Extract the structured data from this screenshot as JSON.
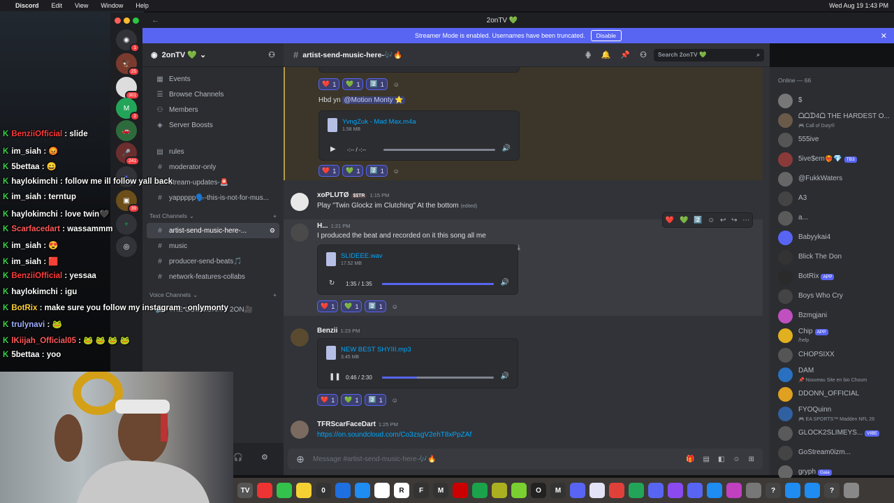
{
  "menubar": {
    "app": "Discord",
    "items": [
      "Edit",
      "View",
      "Window",
      "Help"
    ],
    "datetime": "Wed Aug 19 1:43 PM"
  },
  "window": {
    "title": "2onTV 💚"
  },
  "banner": {
    "text": "Streamer Mode is enabled. Usernames have been truncated.",
    "button": "Disable"
  },
  "guild_rail": {
    "badges": [
      "1",
      "25",
      "301",
      "2",
      "241",
      "39"
    ]
  },
  "sidebar": {
    "guild_name": "2onTV 💚",
    "nav": [
      "Events",
      "Browse Channels",
      "Members",
      "Server Boosts"
    ],
    "channels_top": [
      "rules",
      "moderator-only",
      "stream-updates-🚨",
      "yappppp🗣️-this-is-not-for-mus..."
    ],
    "text_category": "Text Channels",
    "text_channels": [
      "artist-send-music-here-...",
      "music",
      "producer-send-beats🎵",
      "network-features-collabs"
    ],
    "voice_category": "Voice Channels",
    "voice_channels": [
      "THE COMMUNITY 2ON🎥"
    ]
  },
  "chat": {
    "channel": "artist-send-music-here-🎶🔥",
    "search_placeholder": "Search 2onTV 💚",
    "input_placeholder": "Message #artist-send-music-here-🎶🔥",
    "messages": [
      {
        "reactions": [
          "1",
          "1",
          "1"
        ],
        "text": "Hbd yn",
        "mention": "@Motion Monty ⭐",
        "attachment": {
          "name": "YvngZuk - Mad Max.m4a",
          "size": "1.58 MB",
          "time": "-:-- / -:--",
          "progress": 0.0
        },
        "reactions2": [
          "1",
          "1",
          "1"
        ]
      },
      {
        "author": "xoPLUTØ",
        "tag": "$$TR",
        "time": "1:15 PM",
        "text": "Play \"Twin Glockz im Clutching\" At the bottom",
        "edited": "(edited)"
      },
      {
        "author": "H...",
        "time": "1:21 PM",
        "text": "I produced the beat and recorded on it this song all me",
        "attachment": {
          "name": "SLIDEEE.wav",
          "size": "17.52 MB",
          "time": "1:35 / 1:35",
          "progress": 1.0
        },
        "reactions": [
          "1",
          "1",
          "1"
        ]
      },
      {
        "author": "Benzii",
        "time": "1:23 PM",
        "attachment": {
          "name": "NEW BEST SHYIII.mp3",
          "size": "3.45 MB",
          "time": "0:46 / 2:30",
          "progress": 0.31
        },
        "reactions": [
          "1",
          "1",
          "1"
        ]
      },
      {
        "author": "TFRScarFaceDart",
        "time": "1:25 PM",
        "link": "https://on.soundcloud.com/Co3zsgV2ehT8xPpZAf"
      }
    ]
  },
  "members": {
    "header": "Online — 66",
    "list": [
      {
        "name": "$",
        "sub": ""
      },
      {
        "name": "ᗝᗝᗪ4ᗝ THE HARDEST O...",
        "sub": "🎮 Call of Duty®"
      },
      {
        "name": "555ive",
        "sub": ""
      },
      {
        "name": "5ive$em❤️‍🔥💎",
        "sub": "",
        "badge": "TB3"
      },
      {
        "name": "@FukkWaters",
        "sub": ""
      },
      {
        "name": "A3",
        "sub": ""
      },
      {
        "name": "a...",
        "sub": ""
      },
      {
        "name": "Babyykai4",
        "sub": ""
      },
      {
        "name": "Blick The Don",
        "sub": ""
      },
      {
        "name": "BotRix",
        "sub": "",
        "badge": "APP"
      },
      {
        "name": "Boys Who Cry",
        "sub": ""
      },
      {
        "name": "Bzmgjani",
        "sub": ""
      },
      {
        "name": "Chip",
        "sub": "/help",
        "badge": "APP"
      },
      {
        "name": "CHOPSIXX",
        "sub": ""
      },
      {
        "name": "DAM",
        "sub": "📌 Nouveau Site en bio Choum"
      },
      {
        "name": "DDONN_OFFICIAL",
        "sub": ""
      },
      {
        "name": "FYOQuinn",
        "sub": "🎮 EA SPORTS™ Madden NFL 26"
      },
      {
        "name": "GLOCK2SLIMEYS...",
        "sub": "",
        "badge": "VIBE"
      },
      {
        "name": "GoStream0izm...",
        "sub": ""
      },
      {
        "name": "gryph",
        "sub": "",
        "badge": "Gaia"
      }
    ]
  },
  "stream_chat": [
    {
      "user": "BenziiOfficial",
      "msg": ": slide",
      "color": "#ff3d3d"
    },
    {
      "user": "im_siah",
      "msg": ": 😡",
      "color": "#ffffff"
    },
    {
      "user": "5bettaa",
      "msg": ": 😄",
      "color": "#ffffff"
    },
    {
      "user": "haylokimchi",
      "msg": ": follow me ill follow yall back",
      "color": "#ffffff"
    },
    {
      "user": "im_siah",
      "msg": ": terntup",
      "color": "#ffffff"
    },
    {
      "user": "haylokimchi",
      "msg": ": love twin🖤",
      "color": "#ffffff"
    },
    {
      "user": "Scarfacedart",
      "msg": ": wassammm",
      "color": "#ff5a5a"
    },
    {
      "user": "im_siah",
      "msg": ": 😍",
      "color": "#ffffff"
    },
    {
      "user": "im_siah",
      "msg": ": 🟥",
      "color": "#ffffff"
    },
    {
      "user": "BenziiOfficial",
      "msg": ": yessaa",
      "color": "#ff3d3d"
    },
    {
      "user": "haylokimchi",
      "msg": ": igu",
      "color": "#ffffff"
    },
    {
      "user": "BotRix",
      "msg": ": make sure you follow my instagram - onlymonty",
      "color": "#ffd23a"
    },
    {
      "user": "trulynavi",
      "msg": ": 🐸",
      "color": "#9fb0ff"
    },
    {
      "user": "lKiijah_Official05",
      "msg": ": 🐸 🐸 🐸 🐸",
      "color": "#ff5a5a"
    },
    {
      "user": "5bettaa",
      "msg": ": yoo",
      "color": "#ffffff"
    }
  ],
  "dock": [
    "TV",
    "",
    "",
    "",
    "0",
    "",
    "",
    "",
    "R",
    "F",
    "M",
    "",
    "",
    "",
    "",
    "O",
    "M",
    "",
    "",
    "",
    "",
    "",
    "",
    "",
    "",
    "",
    "",
    "?",
    "",
    "",
    "?",
    ""
  ]
}
